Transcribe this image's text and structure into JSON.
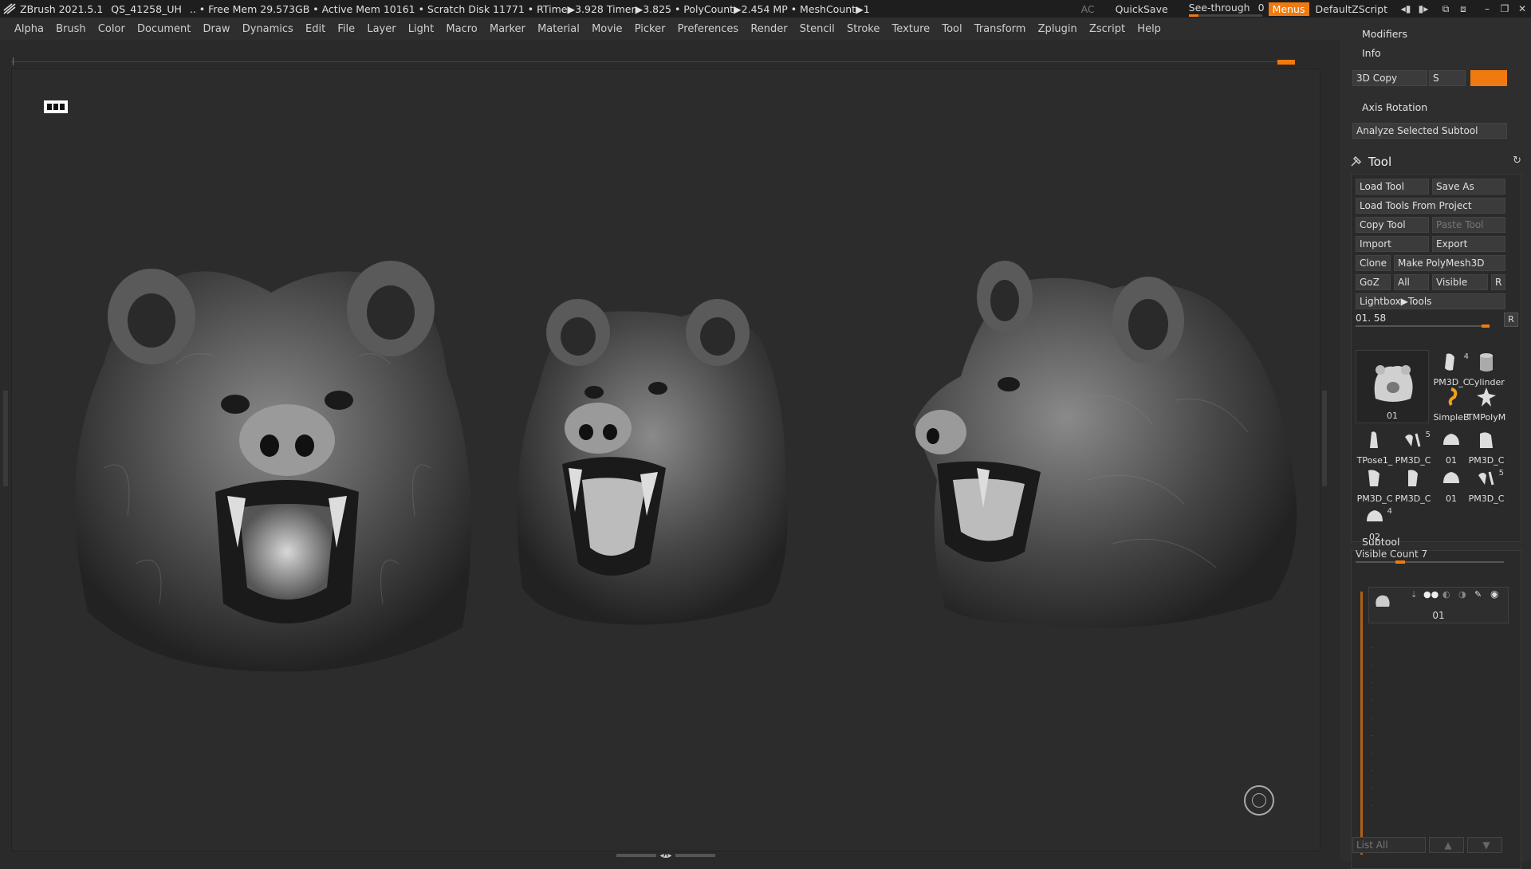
{
  "titlebar": {
    "app": "ZBrush 2021.5.1",
    "project": "QS_41258_UH",
    "status": ".. • Free Mem 29.573GB • Active Mem 10161 • Scratch Disk 11771 • RTime▶3.928 Timer▶3.825 • PolyCount▶2.454 MP • MeshCount▶1",
    "ac": "AC",
    "quicksave": "QuickSave",
    "seethrough_label": "See-through",
    "seethrough_value": "0",
    "seethrough_level": 0,
    "menus": "Menus",
    "default_zscript": "DefaultZScript"
  },
  "menubar": [
    "Alpha",
    "Brush",
    "Color",
    "Document",
    "Draw",
    "Dynamics",
    "Edit",
    "File",
    "Layer",
    "Light",
    "Macro",
    "Marker",
    "Material",
    "Movie",
    "Picker",
    "Preferences",
    "Render",
    "Stencil",
    "Stroke",
    "Texture",
    "Tool",
    "Transform",
    "Zplugin",
    "Zscript",
    "Help"
  ],
  "right_panel": {
    "modifiers": "Modifiers",
    "info": "Info",
    "copy3d": "3D Copy",
    "s_label": "S",
    "axis_rotation": "Axis Rotation",
    "analyze": "Analyze Selected Subtool",
    "tool_title": "Tool",
    "load_tool": "Load Tool",
    "save_as": "Save As",
    "load_from_project": "Load Tools From Project",
    "copy_tool": "Copy Tool",
    "paste_tool": "Paste Tool",
    "import": "Import",
    "export": "Export",
    "clone": "Clone",
    "make_polymesh": "Make PolyMesh3D",
    "goz": "GoZ",
    "all": "All",
    "visible": "Visible",
    "r": "R",
    "lightbox_tools": "Lightbox▶Tools",
    "slider_value": "01. 58",
    "slider_level": 0.95,
    "big_thumb_label": "01",
    "thumbs": [
      {
        "label": "PM3D_C",
        "num": "4"
      },
      {
        "label": "Cylinder",
        "num": ""
      },
      {
        "label": "SimpleB",
        "num": ""
      },
      {
        "label": "TMPolyM",
        "num": ""
      },
      {
        "label": "TPose1_",
        "num": ""
      },
      {
        "label": "PM3D_C",
        "num": "5"
      },
      {
        "label": "01",
        "num": ""
      },
      {
        "label": "PM3D_C",
        "num": ""
      },
      {
        "label": "PM3D_C",
        "num": ""
      },
      {
        "label": "PM3D_C",
        "num": ""
      },
      {
        "label": "01",
        "num": ""
      },
      {
        "label": "PM3D_C",
        "num": "5"
      },
      {
        "label": "02",
        "num": "4"
      }
    ],
    "subtool_title": "Subtool",
    "visible_count": "Visible Count 7",
    "visible_count_level": 0.3,
    "subtool_name": "01",
    "list_all": "List All"
  },
  "colors": {
    "accent": "#f07a10",
    "panel": "#2e2e2e",
    "canvas": "#2c2c2c"
  }
}
